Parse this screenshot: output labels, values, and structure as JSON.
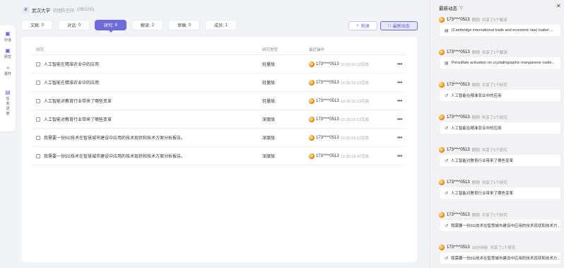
{
  "rail": {
    "items": [
      {
        "icon": "chat-icon",
        "label": "对话"
      },
      {
        "icon": "research-icon",
        "label": "研究"
      },
      {
        "icon": "expand-icon",
        "label": "展开"
      }
    ],
    "task_progress": {
      "icon": "task-icon",
      "label": "任务进度"
    }
  },
  "header": {
    "university": "武汉大学",
    "team_label": "的团队空间",
    "quota": "(0B/10G)"
  },
  "tabs": [
    {
      "label": "文献:",
      "count": "0"
    },
    {
      "label": "对话:",
      "count": "0"
    },
    {
      "label": "研究:",
      "count": "6"
    },
    {
      "label": "解读:",
      "count": "2"
    },
    {
      "label": "审稿:",
      "count": "0"
    },
    {
      "label": "成员:",
      "count": "1"
    }
  ],
  "actions": {
    "new_label": "新建",
    "activity_label": "最新动态"
  },
  "table": {
    "headers": {
      "title": "研究",
      "type": "研究类型",
      "op": "最近操作"
    },
    "rows": [
      {
        "title": "人工智能在精准农业中的应用",
        "type": "轻量版",
        "user": "173****0513",
        "time": "10-30 16:15完成"
      },
      {
        "title": "人工智能在精准农业中的应用",
        "type": "轻量版",
        "user": "173****0513",
        "time": "10-30 16:13完成"
      },
      {
        "title": "人工智能对教育行业带来了哪些变革",
        "type": "轻量版",
        "user": "173****0513",
        "time": "10-30 16:13完成"
      },
      {
        "title": "人工智能对教育行业带来了哪些变革",
        "type": "深度版",
        "user": "173****0513",
        "time": "10-30 16:13完成"
      },
      {
        "title": "我需要一份5G技术在智慧城市建设中应用的技术现状和技术方案分析报告。",
        "type": "深度版",
        "user": "173****0513",
        "time": "10-30 16:13完成"
      },
      {
        "title": "我需要一份5G技术在智慧城市建设中应用的技术现状和技术方案分析报告。",
        "type": "深度版",
        "user": "173****0513",
        "time": "10-30 15:47完成"
      }
    ]
  },
  "panel": {
    "title": "最新动态",
    "items": [
      {
        "user": "173****0513",
        "when": "刚刚",
        "action": "共享了1个解读",
        "icon": "document-icon",
        "text": "(Cambridge international trade and economic law) Isabel ..."
      },
      {
        "user": "173****0513",
        "when": "刚刚",
        "action": "共享了1个解读",
        "icon": "document-icon",
        "text": "Persulfate activation on crystallographic manganese oxide..."
      },
      {
        "user": "173****0513",
        "when": "刚刚",
        "action": "共享了1个研究",
        "icon": "research-icon",
        "text": "人工智能在精准农业中的应用"
      },
      {
        "user": "173****0513",
        "when": "刚刚",
        "action": "共享了1个研究",
        "icon": "research-icon",
        "text": "人工智能在精准农业中的应用"
      },
      {
        "user": "173****0513",
        "when": "刚刚",
        "action": "共享了1个研究",
        "icon": "research-icon",
        "text": "人工智能对教育行业带来了哪些变革"
      },
      {
        "user": "173****0513",
        "when": "刚刚",
        "action": "共享了1个研究",
        "icon": "research-icon",
        "text": "人工智能对教育行业带来了哪些变革"
      },
      {
        "user": "173****0513",
        "when": "刚刚",
        "action": "共享了1个研究",
        "icon": "research-icon",
        "text": "我需要一份5G技术在智慧城市建设中应用的技术现状和技术方..."
      },
      {
        "user": "173****0513",
        "when": "30分钟前",
        "action": "共享了1个研究",
        "icon": "research-icon",
        "text": "我需要一份5G技术在智慧城市建设中应用的技术现状和技术方..."
      }
    ]
  }
}
